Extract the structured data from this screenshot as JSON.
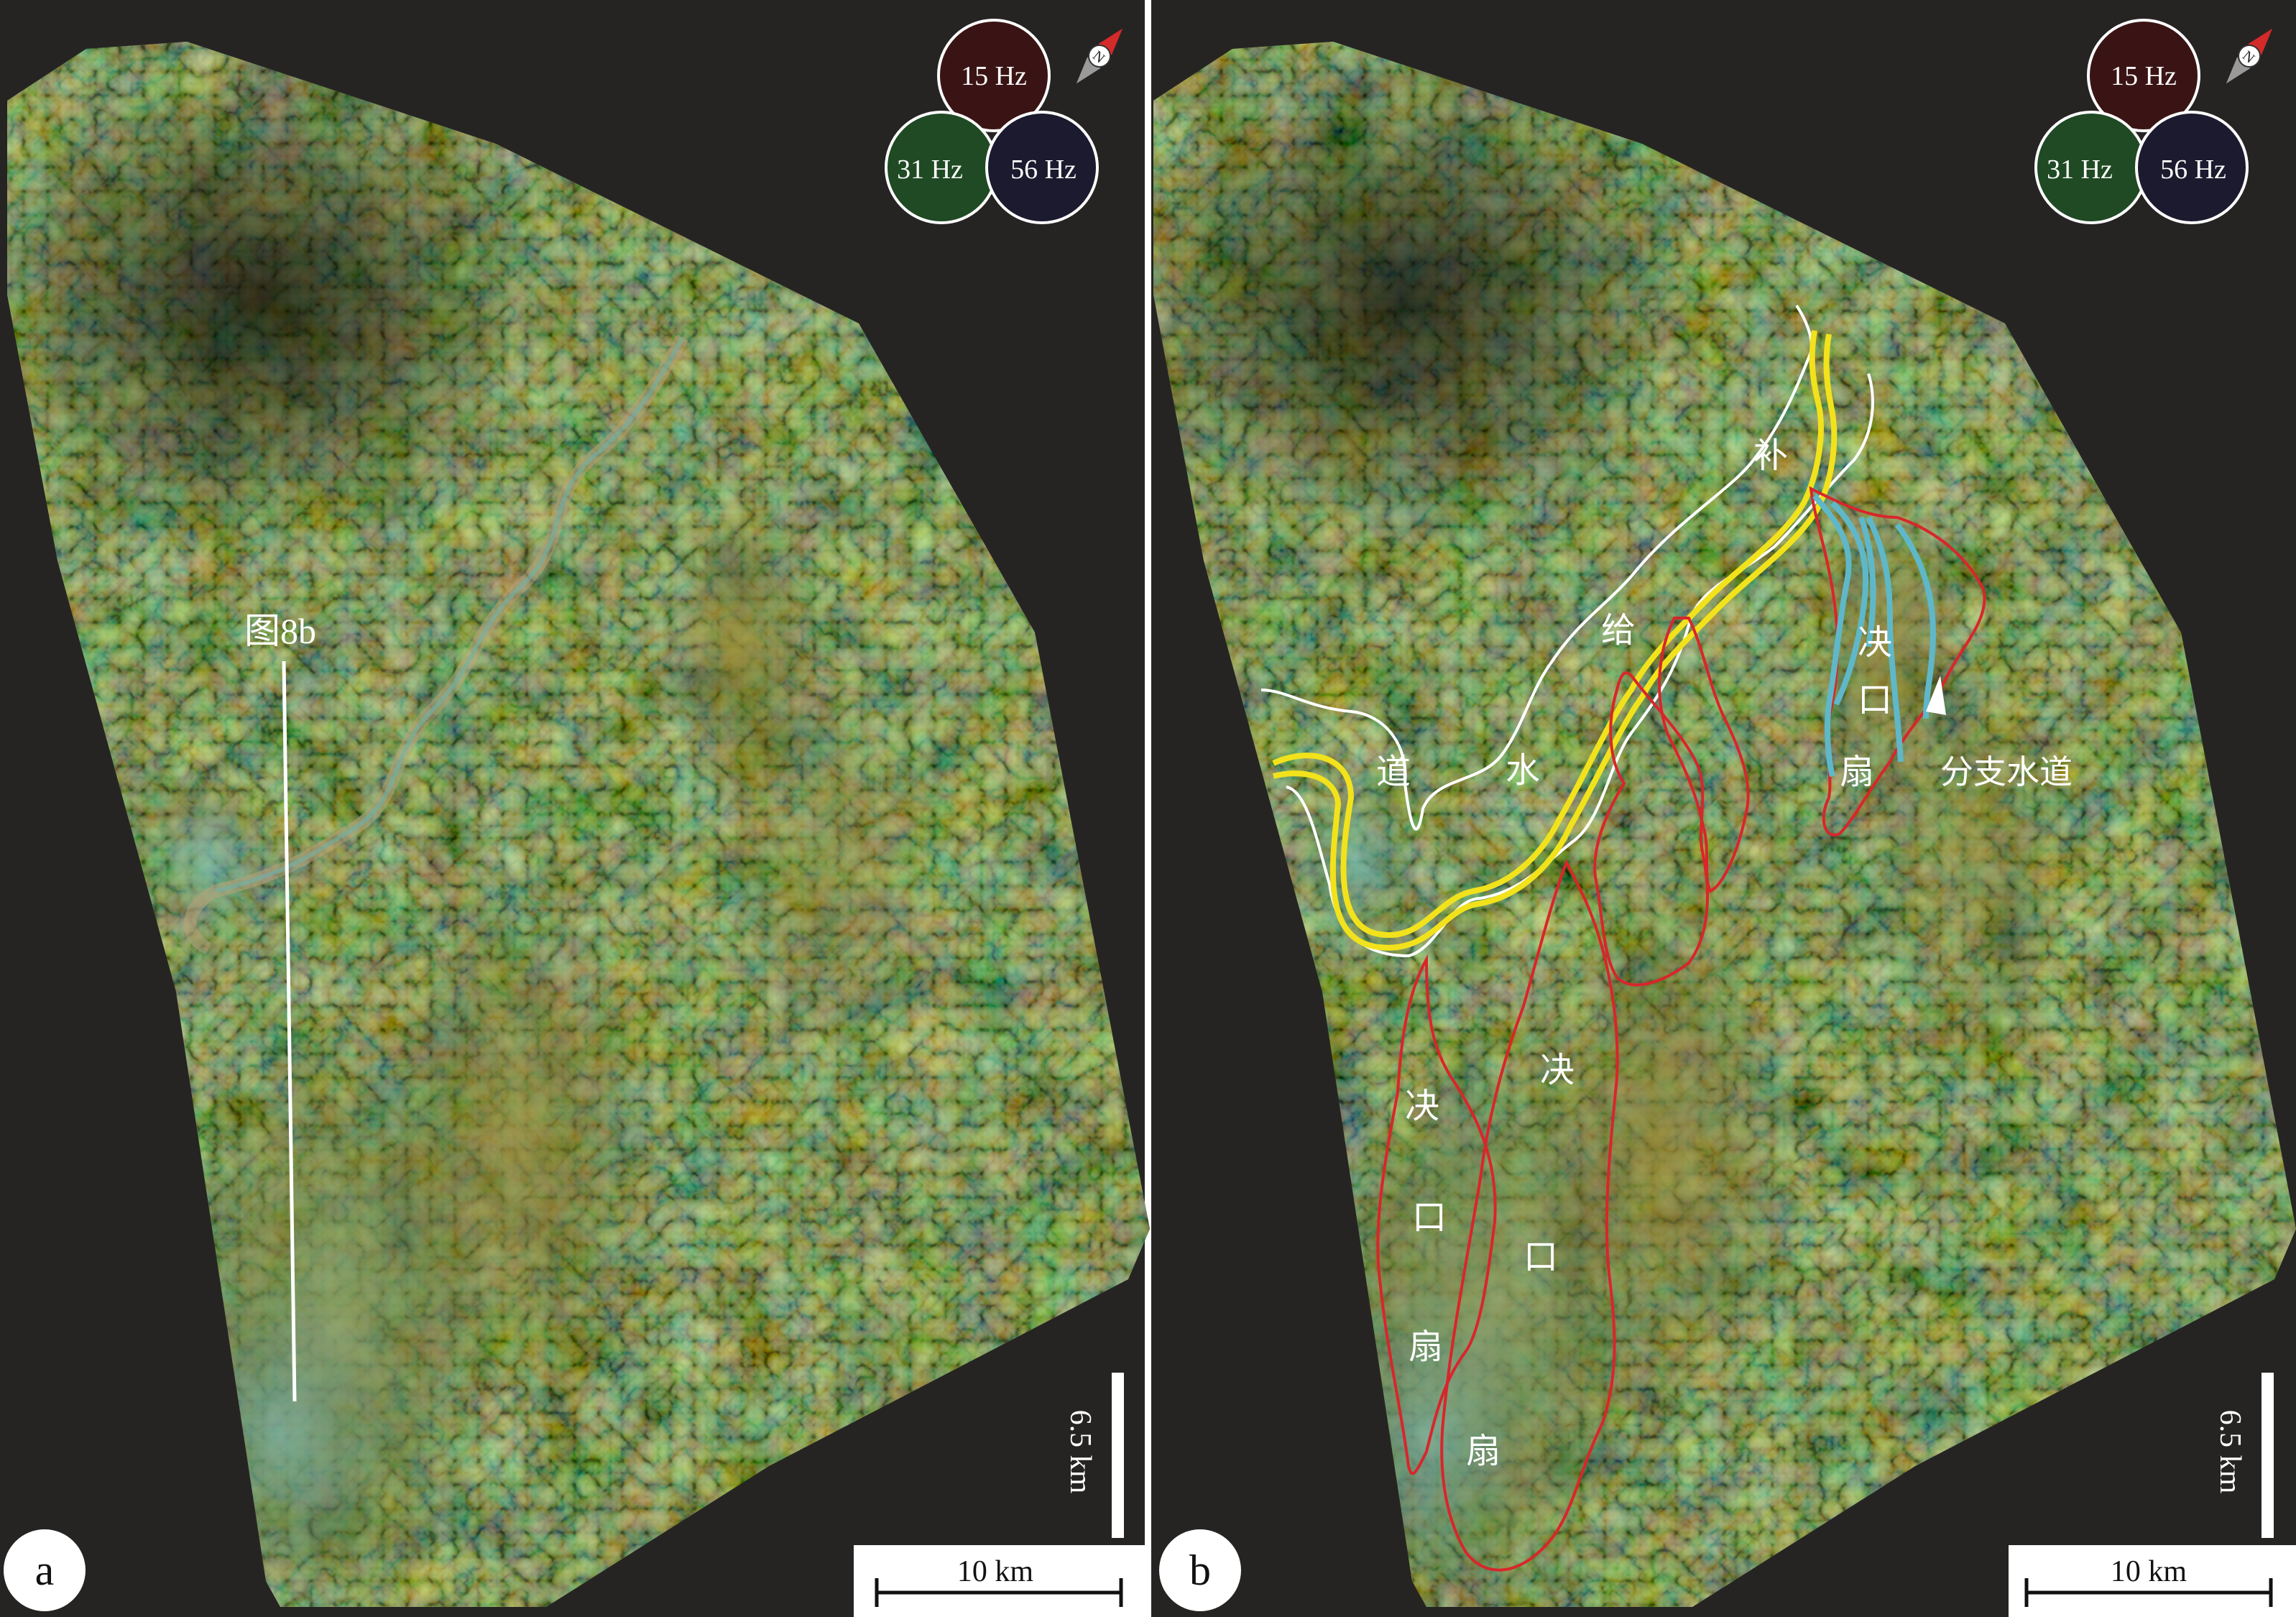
{
  "legend": {
    "red_label": "15 Hz",
    "green_label": "31 Hz",
    "blue_label": "56 Hz"
  },
  "panel_a": {
    "panel_label": "a",
    "section_line_label": "图8b",
    "scale_vertical_label": "6.5 km",
    "scale_horizontal_label": "10 km"
  },
  "panel_b": {
    "panel_label": "b",
    "scale_vertical_label": "6.5 km",
    "scale_horizontal_label": "10 km",
    "supply_channel_chars": [
      "道",
      "水",
      "给",
      "补"
    ],
    "crevasse_fan_west_chars": [
      "决",
      "口",
      "扇"
    ],
    "crevasse_fan_middle_chars": [
      "决",
      "口",
      "扇"
    ],
    "crevasse_fan_east_chars": [
      "决",
      "口",
      "扇"
    ],
    "distributary_channel_label": "分支水道"
  },
  "colors": {
    "background": "#262423",
    "supply_channel_axis": "#f2e21c",
    "supply_channel_boundary": "#ffffff",
    "crevasse_fan_outline": "#d8262b",
    "distributary_channel": "#5fb8c9",
    "red_band": "#3a1414",
    "green_band": "#1f4a24",
    "blue_band": "#1c1a2e"
  }
}
